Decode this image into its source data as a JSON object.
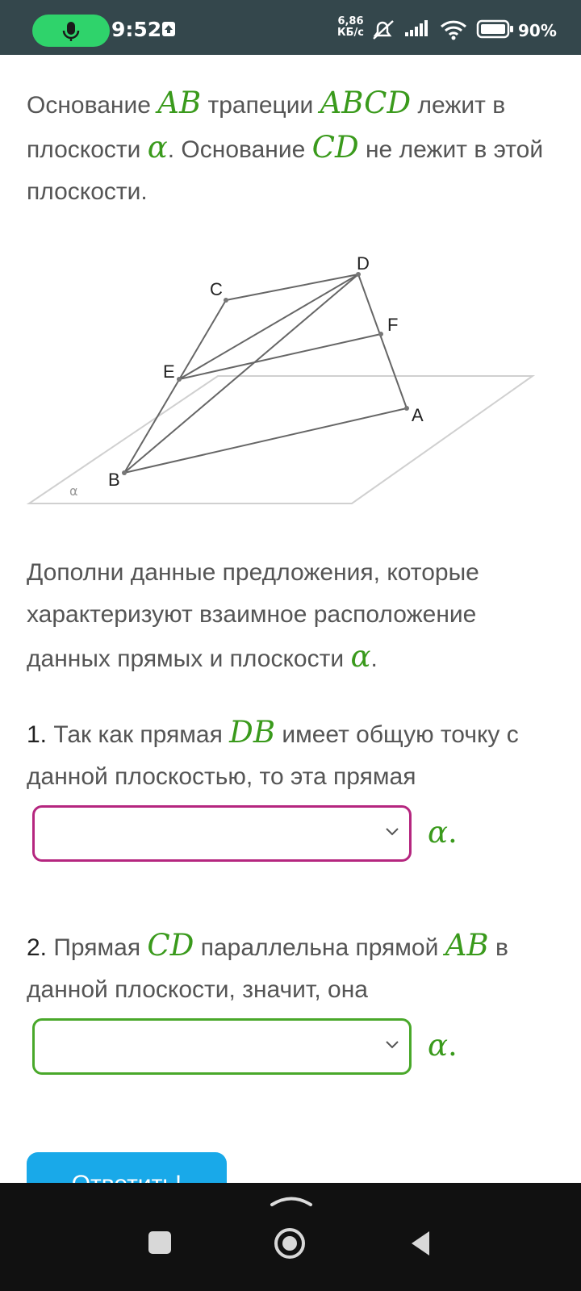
{
  "status_bar": {
    "time": "9:52",
    "net_speed_value": "6,86",
    "net_speed_unit": "КБ/с",
    "battery": "90%"
  },
  "problem": {
    "intro": {
      "t1": "Основание ",
      "m1": "AB",
      "t2": " трапеции ",
      "m2": "ABCD",
      "t3": " лежит в плоскости ",
      "m3": "α",
      "t4": ". Основание ",
      "m4": "CD",
      "t5": " не лежит в этой плоскости."
    },
    "figure": {
      "points": [
        "A",
        "B",
        "C",
        "D",
        "E",
        "F"
      ],
      "plane_label": "α"
    },
    "instruction": {
      "t1": "Дополни данные предложения, которые характеризуют взаимное расположение данных прямых и плоскости ",
      "m1": "α",
      "t2": "."
    },
    "q1": {
      "number": "1.",
      "t1": " Так как прямая ",
      "m1": "DB",
      "t2": " имеет общую точку с данной плоскостью, то эта прямая",
      "select_value": "",
      "after": "α",
      "after_dot": "."
    },
    "q2": {
      "number": "2.",
      "t1": " Прямая ",
      "m1": "CD",
      "t2": " параллельна прямой ",
      "m2": "AB",
      "t3": " в данной плоскости, значит, она",
      "select_value": "",
      "after": "α",
      "after_dot": "."
    },
    "answer_button": "Ответить!"
  },
  "colors": {
    "status_bar": "#34474c",
    "mic_pill": "#2fd36b",
    "math_green": "#3a9a1c",
    "select1_border": "#b5267f",
    "select2_border": "#49a82a",
    "button": "#19a9e9",
    "nav_bar": "#111111"
  },
  "nav_bar": {
    "icons": [
      "chevron-up-icon",
      "square-icon",
      "circle-home-icon",
      "back-triangle-icon"
    ]
  }
}
